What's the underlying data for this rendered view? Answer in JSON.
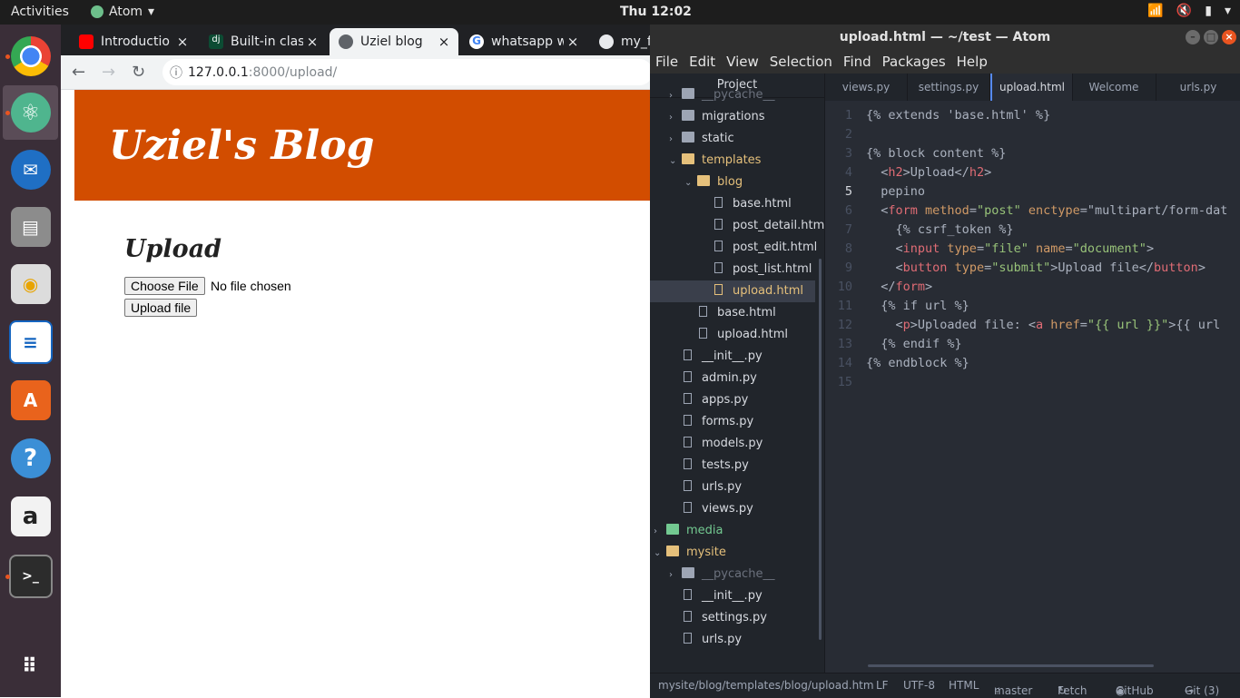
{
  "topbar": {
    "activities": "Activities",
    "app": "Atom",
    "clock": "Thu 12:02"
  },
  "dock": {
    "items": [
      "chrome-icon",
      "atom-icon",
      "thunderbird-icon",
      "files-icon",
      "rhythmbox-icon",
      "writer-icon",
      "software-center-icon",
      "help-icon",
      "amazon-icon",
      "terminal-icon",
      "show-apps-icon"
    ]
  },
  "chrome": {
    "tabs": [
      {
        "title": "Introductio",
        "color": "#ff0000"
      },
      {
        "title": "Built-in clas",
        "color": "#0c4b33"
      },
      {
        "title": "Uziel blog",
        "color": "#5f6368"
      },
      {
        "title": "whatsapp w",
        "color": "#4285f4"
      },
      {
        "title": "my_f",
        "color": "#e8eaed"
      }
    ],
    "url_host": "127.0.0.1",
    "url_path": ":8000/upload/"
  },
  "page": {
    "blog_title": "Uziel's Blog",
    "heading": "Upload",
    "choose_file": "Choose File",
    "no_file": "No file chosen",
    "upload_button": "Upload file"
  },
  "atom": {
    "title": "upload.html — ~/test — Atom",
    "menu": [
      "File",
      "Edit",
      "View",
      "Selection",
      "Find",
      "Packages",
      "Help"
    ],
    "project_header": "Project",
    "tree": [
      {
        "label": "__pycache__",
        "type": "folder",
        "indent": 1,
        "arrow": "›",
        "dim": true
      },
      {
        "label": "migrations",
        "type": "folder",
        "indent": 1,
        "arrow": "›"
      },
      {
        "label": "static",
        "type": "folder",
        "indent": 1,
        "arrow": "›"
      },
      {
        "label": "templates",
        "type": "folder",
        "indent": 1,
        "arrow": "⌄",
        "open": true
      },
      {
        "label": "blog",
        "type": "folder",
        "indent": 2,
        "arrow": "⌄",
        "open": true
      },
      {
        "label": "base.html",
        "type": "file",
        "indent": 3
      },
      {
        "label": "post_detail.html",
        "type": "file",
        "indent": 3
      },
      {
        "label": "post_edit.html",
        "type": "file",
        "indent": 3
      },
      {
        "label": "post_list.html",
        "type": "file",
        "indent": 3
      },
      {
        "label": "upload.html",
        "type": "file",
        "indent": 3,
        "selected": true
      },
      {
        "label": "base.html",
        "type": "file",
        "indent": 2
      },
      {
        "label": "upload.html",
        "type": "file",
        "indent": 2
      },
      {
        "label": "__init__.py",
        "type": "file",
        "indent": 1
      },
      {
        "label": "admin.py",
        "type": "file",
        "indent": 1
      },
      {
        "label": "apps.py",
        "type": "file",
        "indent": 1
      },
      {
        "label": "forms.py",
        "type": "file",
        "indent": 1
      },
      {
        "label": "models.py",
        "type": "file",
        "indent": 1
      },
      {
        "label": "tests.py",
        "type": "file",
        "indent": 1
      },
      {
        "label": "urls.py",
        "type": "file",
        "indent": 1
      },
      {
        "label": "views.py",
        "type": "file",
        "indent": 1
      },
      {
        "label": "media",
        "type": "folder",
        "indent": 0,
        "arrow": "›",
        "green": true
      },
      {
        "label": "mysite",
        "type": "folder",
        "indent": 0,
        "arrow": "⌄",
        "open": true
      },
      {
        "label": "__pycache__",
        "type": "folder",
        "indent": 1,
        "arrow": "›",
        "dim": true
      },
      {
        "label": "__init__.py",
        "type": "file",
        "indent": 1
      },
      {
        "label": "settings.py",
        "type": "file",
        "indent": 1
      },
      {
        "label": "urls.py",
        "type": "file",
        "indent": 1
      }
    ],
    "tabs": [
      {
        "label": "views.py"
      },
      {
        "label": "settings.py"
      },
      {
        "label": "upload.html",
        "active": true
      },
      {
        "label": "Welcome"
      },
      {
        "label": "urls.py"
      }
    ],
    "current_line": 5,
    "code_lines": [
      "{% extends 'base.html' %}",
      "",
      "{% block content %}",
      "  <h2>Upload</h2>",
      "  pepino",
      "  <form method=\"post\" enctype=\"multipart/form-dat",
      "    {% csrf_token %}",
      "    <input type=\"file\" name=\"document\">",
      "    <button type=\"submit\">Upload file</button>",
      "  </form>",
      "  {% if url %}",
      "    <p>Uploaded file: <a href=\"{{ url }}\">{{ url",
      "  {% endif %}",
      "{% endblock %}",
      ""
    ],
    "status": {
      "path": "mysite/blog/templates/blog/upload.htm",
      "eol": "LF",
      "encoding": "UTF-8",
      "grammar": "HTML",
      "branch": "master",
      "fetch": "Fetch",
      "github": "GitHub",
      "git": "Git (3)"
    }
  }
}
